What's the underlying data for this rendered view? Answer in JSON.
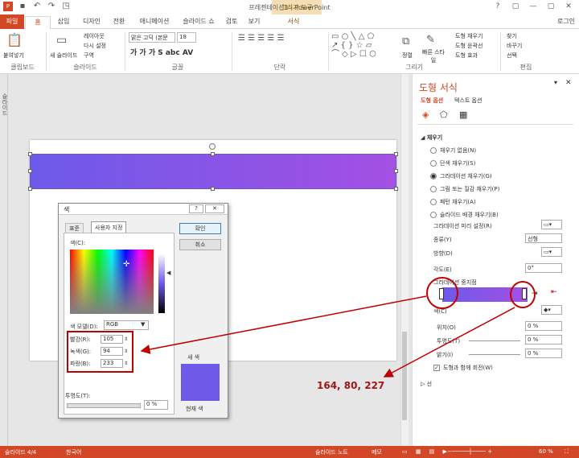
{
  "window": {
    "title": "프레젠테이션1 - PowerPoint",
    "context_group": "그리기 도구",
    "user": "로그인",
    "buttons": [
      "?",
      "▢",
      "—",
      "▢",
      "✕"
    ]
  },
  "tabs": [
    "파일",
    "홈",
    "삽입",
    "디자인",
    "전환",
    "애니메이션",
    "슬라이드 쇼",
    "검토",
    "보기",
    "서식"
  ],
  "ribbon": {
    "clipboard": {
      "paste": "붙여넣기",
      "label": "클립보드"
    },
    "slides": {
      "new_slide": "새 슬라이드",
      "layout": "레이아웃",
      "reset": "다시 설정",
      "section": "구역",
      "label": "슬라이드"
    },
    "font": {
      "font_name": "맑은 고딕 (본문",
      "font_size": "18",
      "label": "글꼴"
    },
    "paragraph": {
      "label": "단락"
    },
    "drawing": {
      "arrange": "정렬",
      "quick_styles": "빠른 스타일",
      "fill": "도형 채우기",
      "outline": "도형 윤곽선",
      "effects": "도형 효과",
      "label": "그리기"
    },
    "editing": {
      "find": "찾기",
      "replace": "바꾸기",
      "select": "선택",
      "label": "편집"
    }
  },
  "slide_panel": {
    "label": "슬라이드"
  },
  "dialog": {
    "title": "색",
    "help": "?",
    "close": "✕",
    "tabs": [
      "표준",
      "사용자 지정"
    ],
    "ok": "확인",
    "cancel": "취소",
    "color_label": "색(C):",
    "color_model_label": "색 모델(D):",
    "color_model": "RGB",
    "red_label": "빨강(R):",
    "red": "105",
    "green_label": "녹색(G):",
    "green": "94",
    "blue_label": "파랑(B):",
    "blue": "233",
    "new_label": "새 색",
    "current_label": "현재 색",
    "transparency_label": "투명도(T):",
    "transparency": "0 %",
    "new_color": "#6d5ae9",
    "current_color": "#6d5ae9"
  },
  "format_pane": {
    "title": "도형 서식",
    "tab_shape": "도형 옵션",
    "tab_text": "텍스트 옵션",
    "fill_header": "채우기",
    "fill_options": [
      "채우기 없음(N)",
      "단색 채우기(S)",
      "그라데이션 채우기(G)",
      "그림 또는 질감 채우기(P)",
      "패턴 채우기(A)",
      "슬라이드 배경 채우기(B)"
    ],
    "fill_selected": 2,
    "preset_label": "그라데이션 미리 설정(R)",
    "type_label": "종류(Y)",
    "type_value": "선형",
    "direction_label": "방향(D)",
    "angle_label": "각도(E)",
    "angle_value": "0°",
    "stops_label": "그라데이션 중지점",
    "color_label": "색(C)",
    "position_label": "위치(O)",
    "position_value": "0 %",
    "transparency_label": "투명도(T)",
    "transparency_value": "0 %",
    "brightness_label": "밝기(I)",
    "brightness_value": "0 %",
    "rotate_label": "도형과 함께 회전(W)",
    "line_header": "선"
  },
  "annotation": "164, 80, 227",
  "gradient_colors": {
    "start": "#6d5ae9",
    "end": "#a450e3",
    "annot": "#c00000"
  },
  "status": {
    "slide": "슬라이드 4/4",
    "lang": "한국어",
    "notes": "슬라이드 노트",
    "memo": "메모",
    "zoom": "60 %"
  }
}
